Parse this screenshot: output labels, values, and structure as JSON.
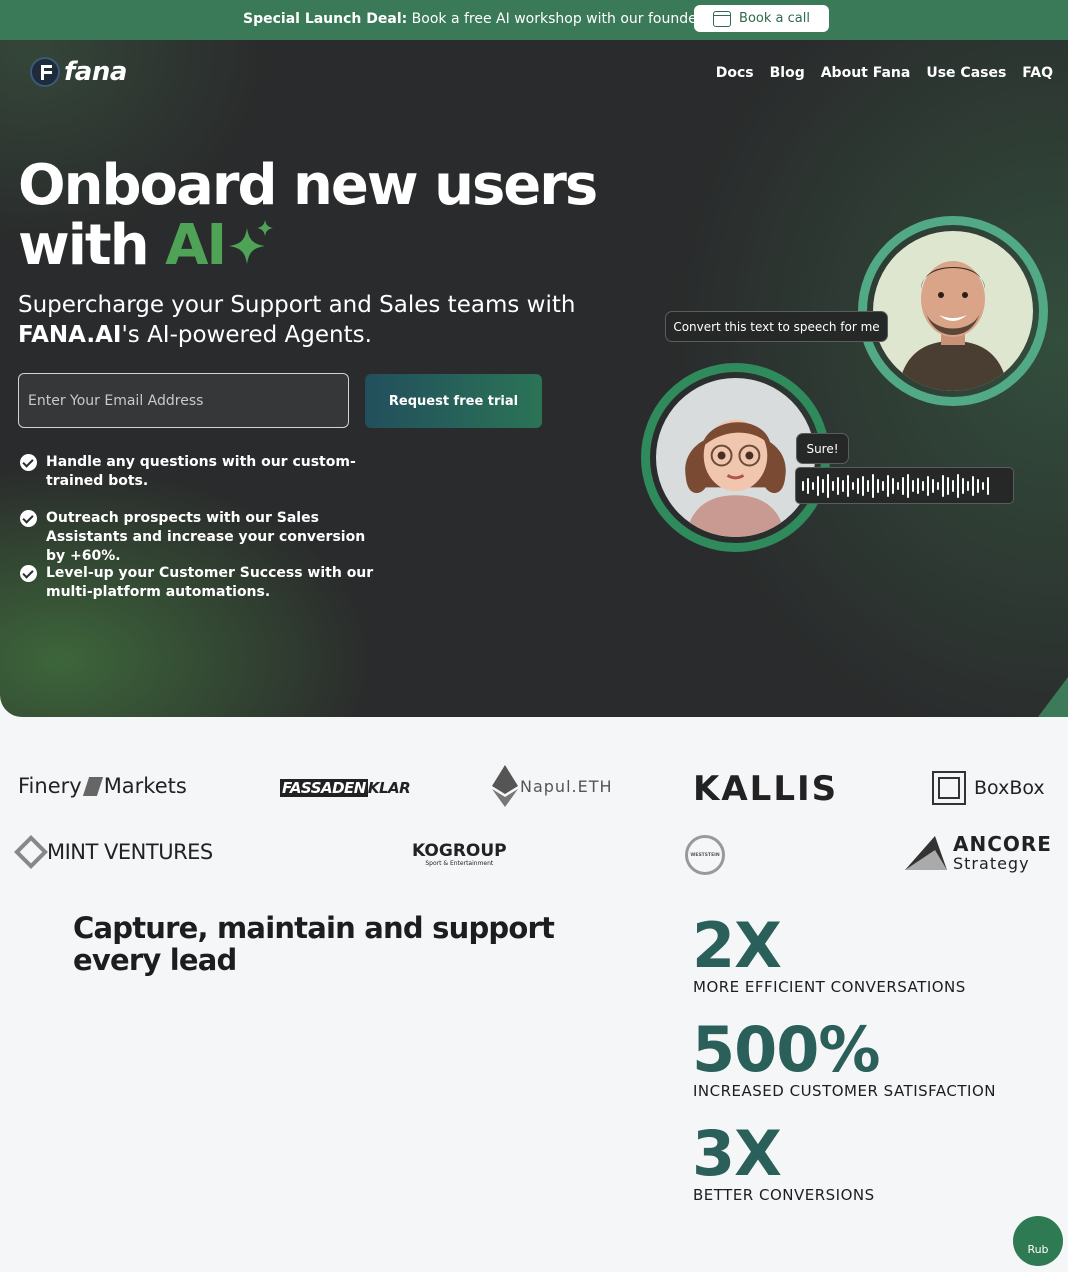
{
  "promo": {
    "lead": "Special Launch Deal:",
    "text": " Book a free AI workshop with our founders",
    "button": "Book a call"
  },
  "brand": {
    "name": "fana"
  },
  "nav": [
    "Docs",
    "Blog",
    "About Fana",
    "Use Cases",
    "FAQ"
  ],
  "hero": {
    "headline_line1": "Onboard new users",
    "headline_with": "with ",
    "headline_ai": "AI",
    "subtitle_pre": "Supercharge your Support and Sales teams with ",
    "subtitle_brand": "FANA.AI",
    "subtitle_post": "'s AI-powered Agents.",
    "email_placeholder": "Enter Your Email Address",
    "cta": "Request free trial",
    "features": [
      "Handle any questions with our custom-trained bots.",
      "Outreach prospects with our Sales Assistants and increase your conversion by +60%.",
      "Level-up your Customer Success with our multi-platform automations."
    ],
    "bubble_convert": "Convert this text to speech for me",
    "bubble_sure": "Sure!"
  },
  "logos": {
    "finery_a": "Finery",
    "finery_b": "Markets",
    "fassaden_a": "FASSADEN",
    "fassaden_b": "KLAR",
    "napul": "Napul.ETH",
    "kallis": "KALLIS",
    "boxbox": "BoxBox",
    "mint": "MINT VENTURES",
    "kogroup": "KOGROUP",
    "kogroup_sub": "Sport & Entertainment",
    "weststein": "WESTSTEIN",
    "ancore_a": "ANCORE",
    "ancore_b": "Strategy"
  },
  "capture": {
    "title": "Capture, maintain and support every lead",
    "stats": [
      {
        "value": "2X",
        "label": "MORE EFFICIENT CONVERSATIONS"
      },
      {
        "value": "500%",
        "label": "INCREASED CUSTOMER SATISFACTION"
      },
      {
        "value": "3X",
        "label": "BETTER CONVERSIONS"
      }
    ]
  },
  "chat_widget": {
    "label": "Rub"
  },
  "colors": {
    "accent": "#3b7a59",
    "ai_green": "#4fa356",
    "stat": "#2a5f5a",
    "hero_bg": "#2a2b2c"
  }
}
